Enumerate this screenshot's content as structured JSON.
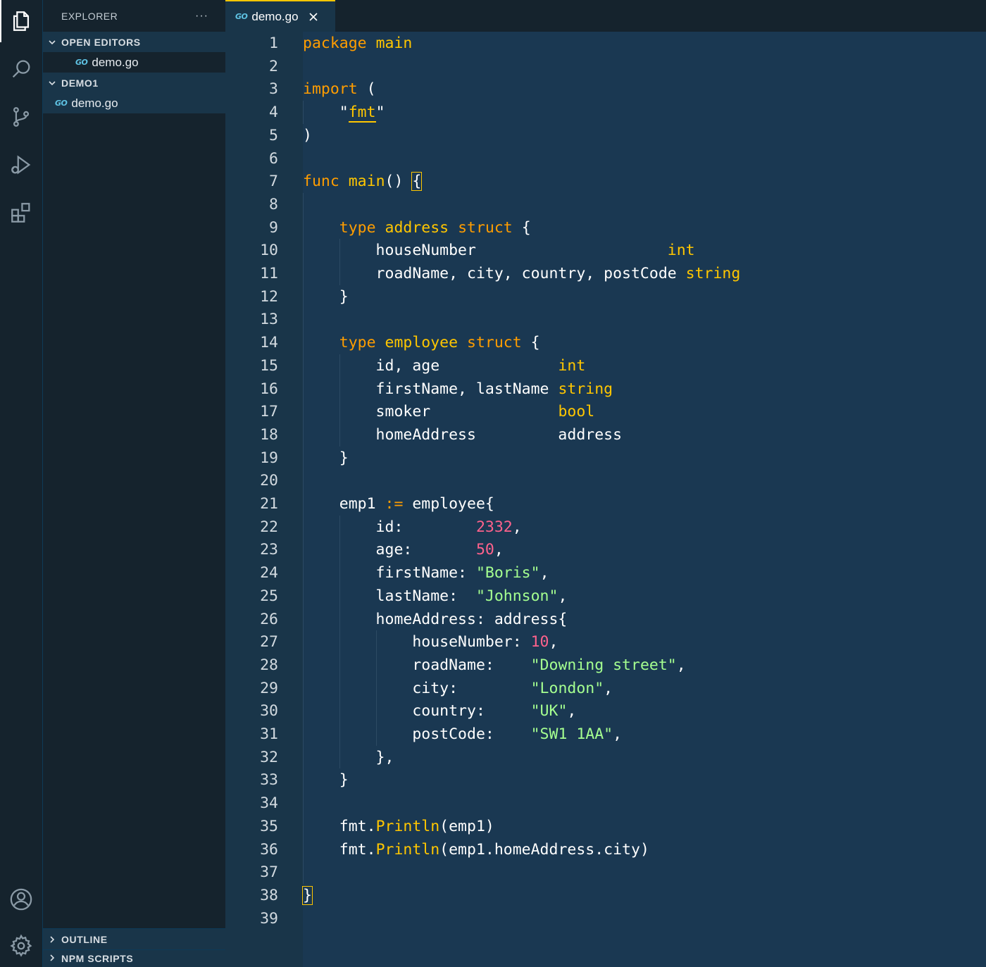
{
  "sidebar": {
    "title": "EXPLORER",
    "more": "···",
    "open_editors": {
      "label": "OPEN EDITORS",
      "files": [
        {
          "icon": "GO",
          "name": "demo.go"
        }
      ]
    },
    "project": {
      "label": "DEMO1",
      "files": [
        {
          "icon": "GO",
          "name": "demo.go"
        }
      ]
    },
    "bottom_sections": [
      {
        "label": "OUTLINE"
      },
      {
        "label": "NPM SCRIPTS"
      }
    ]
  },
  "activity_bar": {
    "icons": [
      "files-icon",
      "search-icon",
      "source-control-icon",
      "run-debug-icon",
      "extensions-icon",
      "account-icon",
      "settings-gear-icon"
    ]
  },
  "editor": {
    "tab": {
      "icon": "GO",
      "label": "demo.go"
    },
    "colors": {
      "keyword": "#ff9d00",
      "type": "#ffc600",
      "string": "#a5ff90",
      "number": "#ff628c",
      "background": "#193549"
    },
    "lines": [
      [
        [
          "kw",
          "package"
        ],
        [
          "pu",
          " "
        ],
        [
          "ty",
          "main"
        ]
      ],
      [],
      [
        [
          "kw",
          "import"
        ],
        [
          "pu",
          " ("
        ]
      ],
      [
        [
          "pu",
          "    \""
        ],
        [
          "ty",
          "fmt"
        ],
        [
          "pu",
          "\""
        ]
      ],
      [
        [
          "pu",
          ")"
        ]
      ],
      [],
      [
        [
          "kw",
          "func"
        ],
        [
          "pu",
          " "
        ],
        [
          "ty",
          "main"
        ],
        [
          "pu",
          "() {"
        ]
      ],
      [],
      [
        [
          "pu",
          "    "
        ],
        [
          "kw",
          "type"
        ],
        [
          "pu",
          " "
        ],
        [
          "ty",
          "address"
        ],
        [
          "pu",
          " "
        ],
        [
          "kw",
          "struct"
        ],
        [
          "pu",
          " {"
        ]
      ],
      [
        [
          "pu",
          "        houseNumber                     "
        ],
        [
          "ty",
          "int"
        ]
      ],
      [
        [
          "pu",
          "        roadName, city, country, postCode "
        ],
        [
          "ty",
          "string"
        ]
      ],
      [
        [
          "pu",
          "    }"
        ]
      ],
      [],
      [
        [
          "pu",
          "    "
        ],
        [
          "kw",
          "type"
        ],
        [
          "pu",
          " "
        ],
        [
          "ty",
          "employee"
        ],
        [
          "pu",
          " "
        ],
        [
          "kw",
          "struct"
        ],
        [
          "pu",
          " {"
        ]
      ],
      [
        [
          "pu",
          "        id, age             "
        ],
        [
          "ty",
          "int"
        ]
      ],
      [
        [
          "pu",
          "        firstName, lastName "
        ],
        [
          "ty",
          "string"
        ]
      ],
      [
        [
          "pu",
          "        smoker              "
        ],
        [
          "ty",
          "bool"
        ]
      ],
      [
        [
          "pu",
          "        homeAddress         address"
        ]
      ],
      [
        [
          "pu",
          "    }"
        ]
      ],
      [],
      [
        [
          "pu",
          "    emp1 "
        ],
        [
          "kw",
          ":="
        ],
        [
          "pu",
          " employee{"
        ]
      ],
      [
        [
          "pu",
          "        id:        "
        ],
        [
          "nu",
          "2332"
        ],
        [
          "pu",
          ","
        ]
      ],
      [
        [
          "pu",
          "        age:       "
        ],
        [
          "nu",
          "50"
        ],
        [
          "pu",
          ","
        ]
      ],
      [
        [
          "pu",
          "        firstName: "
        ],
        [
          "st",
          "\"Boris\""
        ],
        [
          "pu",
          ","
        ]
      ],
      [
        [
          "pu",
          "        lastName:  "
        ],
        [
          "st",
          "\"Johnson\""
        ],
        [
          "pu",
          ","
        ]
      ],
      [
        [
          "pu",
          "        homeAddress: address{"
        ]
      ],
      [
        [
          "pu",
          "            houseNumber: "
        ],
        [
          "nu",
          "10"
        ],
        [
          "pu",
          ","
        ]
      ],
      [
        [
          "pu",
          "            roadName:    "
        ],
        [
          "st",
          "\"Downing street\""
        ],
        [
          "pu",
          ","
        ]
      ],
      [
        [
          "pu",
          "            city:        "
        ],
        [
          "st",
          "\"London\""
        ],
        [
          "pu",
          ","
        ]
      ],
      [
        [
          "pu",
          "            country:     "
        ],
        [
          "st",
          "\"UK\""
        ],
        [
          "pu",
          ","
        ]
      ],
      [
        [
          "pu",
          "            postCode:    "
        ],
        [
          "st",
          "\"SW1 1AA\""
        ],
        [
          "pu",
          ","
        ]
      ],
      [
        [
          "pu",
          "        },"
        ]
      ],
      [
        [
          "pu",
          "    }"
        ]
      ],
      [],
      [
        [
          "pu",
          "    fmt."
        ],
        [
          "ty",
          "Println"
        ],
        [
          "pu",
          "(emp1)"
        ]
      ],
      [
        [
          "pu",
          "    fmt."
        ],
        [
          "ty",
          "Println"
        ],
        [
          "pu",
          "(emp1.homeAddress.city)"
        ]
      ],
      [],
      [
        [
          "pu",
          "}"
        ]
      ],
      []
    ]
  }
}
